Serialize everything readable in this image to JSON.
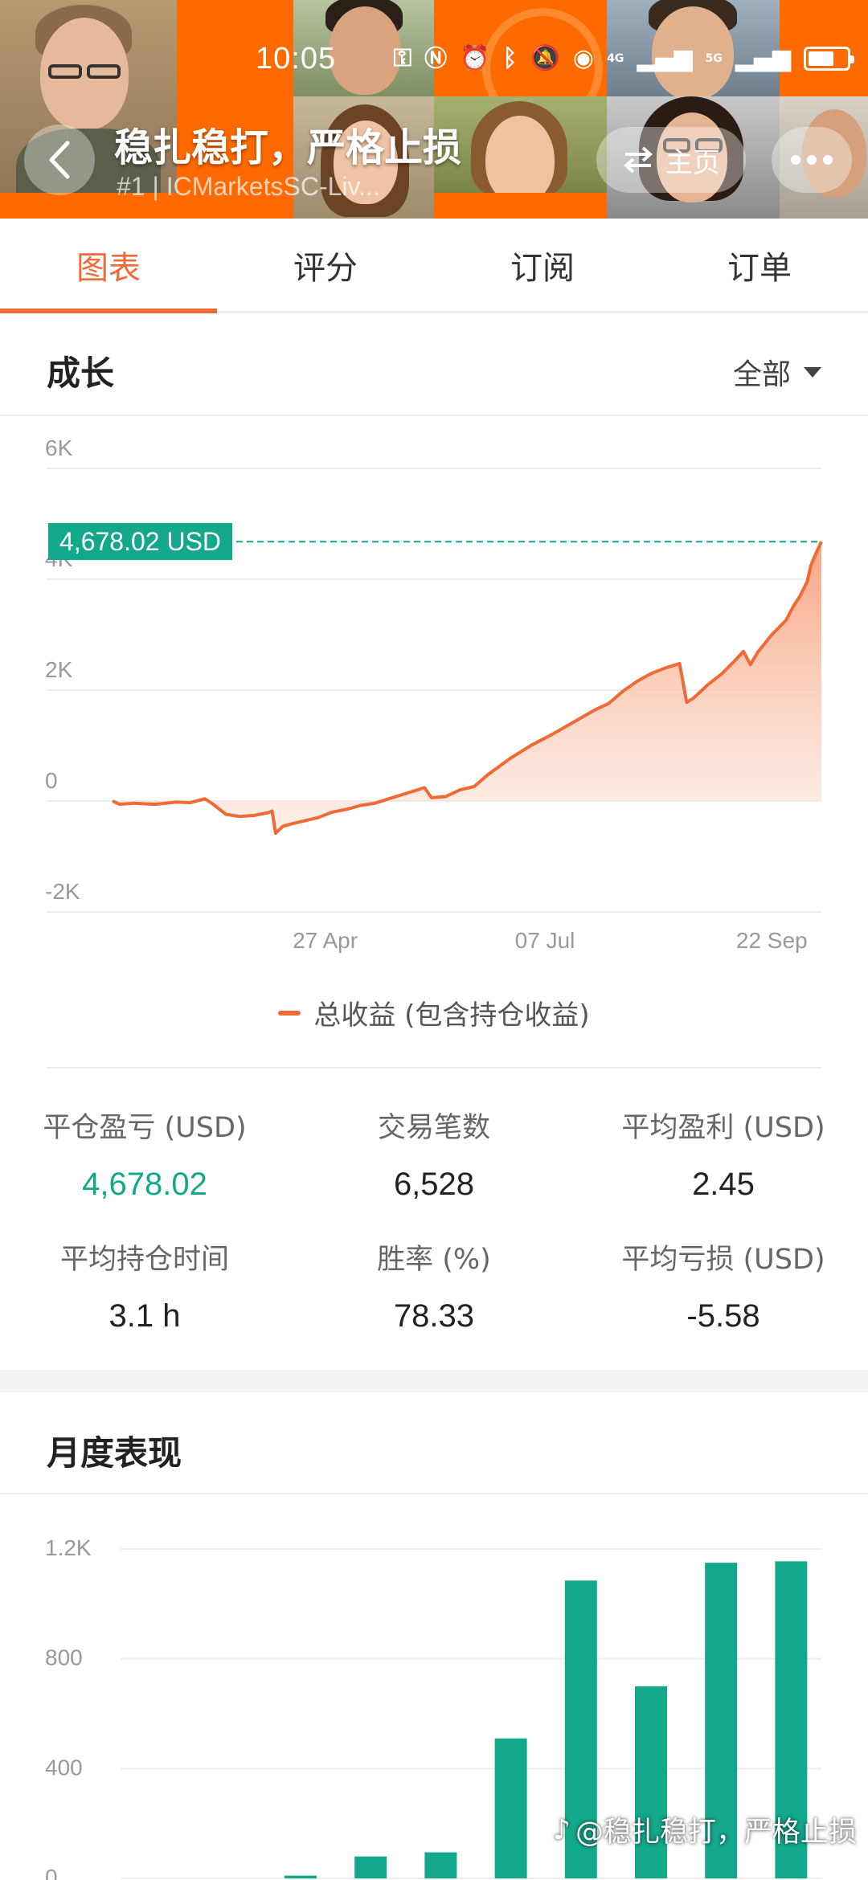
{
  "status_bar": {
    "time": "10:05",
    "signal_1": "4G",
    "signal_2": "5G"
  },
  "header": {
    "back_icon": "chevron-left-icon",
    "title": "稳扎稳打，严格止损",
    "subtitle": "#1 | ICMarketsSC-Liv...",
    "home_label": "主页",
    "home_icon": "swap-arrows-icon",
    "more_icon": "more-dots-icon"
  },
  "tabs": [
    {
      "label": "图表",
      "active": true
    },
    {
      "label": "评分",
      "active": false
    },
    {
      "label": "订阅",
      "active": false
    },
    {
      "label": "订单",
      "active": false
    }
  ],
  "growth": {
    "title": "成长",
    "filter_label": "全部",
    "current_value_label": "4,678.02 USD",
    "legend_label": "总收益 (包含持仓收益)"
  },
  "chart_data": [
    {
      "type": "area",
      "title": "成长",
      "ylim": [
        -2000,
        6000
      ],
      "yticks": [
        -2000,
        0,
        2000,
        4000,
        6000
      ],
      "ytick_labels": [
        "-2K",
        "0",
        "2K",
        "4K",
        "6K"
      ],
      "xtick_labels": [
        "27 Apr",
        "07 Jul",
        "22 Sep"
      ],
      "line_color": "#f06a36",
      "annotation": "4,678.02 USD",
      "series": [
        {
          "name": "总收益 (包含持仓收益)",
          "points": [
            [
              0.0,
              0
            ],
            [
              0.01,
              -60
            ],
            [
              0.03,
              -40
            ],
            [
              0.06,
              -60
            ],
            [
              0.09,
              -20
            ],
            [
              0.11,
              -30
            ],
            [
              0.13,
              40
            ],
            [
              0.14,
              -40
            ],
            [
              0.16,
              -240
            ],
            [
              0.18,
              -280
            ],
            [
              0.2,
              -260
            ],
            [
              0.22,
              -210
            ],
            [
              0.225,
              -180
            ],
            [
              0.23,
              -580
            ],
            [
              0.235,
              -520
            ],
            [
              0.24,
              -460
            ],
            [
              0.25,
              -420
            ],
            [
              0.27,
              -360
            ],
            [
              0.29,
              -300
            ],
            [
              0.31,
              -200
            ],
            [
              0.33,
              -150
            ],
            [
              0.35,
              -80
            ],
            [
              0.37,
              -40
            ],
            [
              0.39,
              40
            ],
            [
              0.41,
              120
            ],
            [
              0.43,
              200
            ],
            [
              0.44,
              240
            ],
            [
              0.45,
              60
            ],
            [
              0.47,
              80
            ],
            [
              0.49,
              200
            ],
            [
              0.51,
              260
            ],
            [
              0.53,
              480
            ],
            [
              0.56,
              760
            ],
            [
              0.59,
              1000
            ],
            [
              0.62,
              1200
            ],
            [
              0.65,
              1420
            ],
            [
              0.68,
              1640
            ],
            [
              0.7,
              1760
            ],
            [
              0.72,
              1980
            ],
            [
              0.74,
              2160
            ],
            [
              0.76,
              2300
            ],
            [
              0.78,
              2400
            ],
            [
              0.79,
              2440
            ],
            [
              0.8,
              2480
            ],
            [
              0.81,
              1780
            ],
            [
              0.82,
              1860
            ],
            [
              0.84,
              2100
            ],
            [
              0.86,
              2300
            ],
            [
              0.88,
              2560
            ],
            [
              0.89,
              2700
            ],
            [
              0.9,
              2460
            ],
            [
              0.91,
              2680
            ],
            [
              0.93,
              3000
            ],
            [
              0.95,
              3260
            ],
            [
              0.96,
              3500
            ],
            [
              0.97,
              3700
            ],
            [
              0.98,
              3960
            ],
            [
              0.985,
              4240
            ],
            [
              0.99,
              4400
            ],
            [
              1.0,
              4678.02
            ]
          ]
        }
      ]
    },
    {
      "type": "bar",
      "title": "月度表现",
      "ylim": [
        0,
        1200
      ],
      "yticks": [
        0,
        400,
        800,
        1200
      ],
      "ytick_labels": [
        "0",
        "400",
        "800",
        "1.2K"
      ],
      "bar_color": "#13a88b",
      "values": [
        0,
        0,
        10,
        80,
        95,
        510,
        1085,
        700,
        1150,
        1155
      ]
    }
  ],
  "stats": [
    {
      "label": "平仓盈亏 (USD)",
      "value": "4,678.02",
      "color": "green"
    },
    {
      "label": "交易笔数",
      "value": "6,528",
      "color": "default"
    },
    {
      "label": "平均盈利 (USD)",
      "value": "2.45",
      "color": "default"
    },
    {
      "label": "平均持仓时间",
      "value": "3.1 h",
      "color": "default"
    },
    {
      "label": "胜率 (%)",
      "value": "78.33",
      "color": "default"
    },
    {
      "label": "平均亏损 (USD)",
      "value": "-5.58",
      "color": "default"
    }
  ],
  "monthly": {
    "title": "月度表现"
  },
  "watermark": {
    "text": "@稳扎稳打，严格止损",
    "icon": "tiktok-logo-icon"
  },
  "colors": {
    "accent": "#f06a36",
    "positive": "#13a88b",
    "header_orange": "#ff6a00"
  }
}
